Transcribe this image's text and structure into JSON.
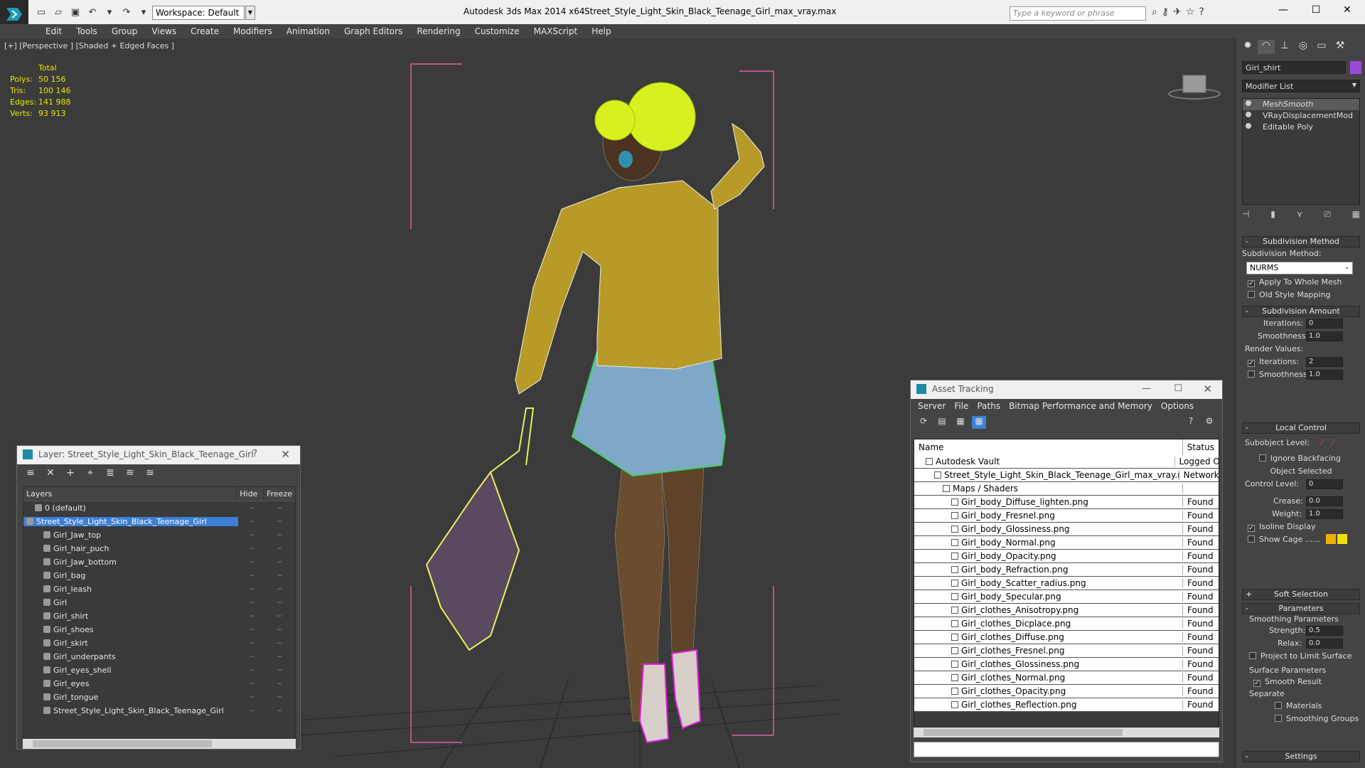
{
  "titlebar": {
    "app_title": "Autodesk 3ds Max  2014 x64",
    "file_title": "Street_Style_Light_Skin_Black_Teenage_Girl_max_vray.max",
    "workspace": "Workspace: Default",
    "search_placeholder": "Type a keyword or phrase"
  },
  "menu": [
    "Edit",
    "Tools",
    "Group",
    "Views",
    "Create",
    "Modifiers",
    "Animation",
    "Graph Editors",
    "Rendering",
    "Customize",
    "MAXScript",
    "Help"
  ],
  "viewport": {
    "label": "[+] [Perspective ] [Shaded + Edged Faces ]",
    "stats": {
      "header": "Total",
      "rows": [
        {
          "k": "Polys:",
          "v": "50 156"
        },
        {
          "k": "Tris:",
          "v": "100 146"
        },
        {
          "k": "Edges:",
          "v": "141 988"
        },
        {
          "k": "Verts:",
          "v": "93 913"
        }
      ]
    }
  },
  "layer_dialog": {
    "title": "Layer: Street_Style_Light_Skin_Black_Teenage_Girl",
    "help": "?",
    "close": "✕",
    "headers": {
      "name": "Layers",
      "hide": "Hide",
      "freeze": "Freeze"
    },
    "rows": [
      {
        "name": "0 (default)",
        "indent": 1
      },
      {
        "name": "Street_Style_Light_Skin_Black_Teenage_Girl",
        "indent": 0,
        "selected": true
      },
      {
        "name": "Girl_Jaw_top",
        "indent": 2
      },
      {
        "name": "Girl_hair_puch",
        "indent": 2
      },
      {
        "name": "Girl_Jaw_bottom",
        "indent": 2
      },
      {
        "name": "Girl_bag",
        "indent": 2
      },
      {
        "name": "Girl_leash",
        "indent": 2
      },
      {
        "name": "Girl",
        "indent": 2
      },
      {
        "name": "Girl_shirt",
        "indent": 2
      },
      {
        "name": "Girl_shoes",
        "indent": 2
      },
      {
        "name": "Girl_skirt",
        "indent": 2
      },
      {
        "name": "Girl_underpants",
        "indent": 2
      },
      {
        "name": "Girl_eyes_shell",
        "indent": 2
      },
      {
        "name": "Girl_eyes",
        "indent": 2
      },
      {
        "name": "Girl_tongue",
        "indent": 2
      },
      {
        "name": "Street_Style_Light_Skin_Black_Teenage_Girl",
        "indent": 2
      }
    ]
  },
  "asset_dialog": {
    "title": "Asset Tracking",
    "menu": [
      "Server",
      "File",
      "Paths",
      "Bitmap Performance and Memory",
      "Options"
    ],
    "headers": {
      "name": "Name",
      "status": "Status"
    },
    "rows": [
      {
        "name": "Autodesk Vault",
        "status": "Logged O",
        "indent": 1
      },
      {
        "name": "Street_Style_Light_Skin_Black_Teenage_Girl_max_vray.max",
        "status": "Network",
        "indent": 2
      },
      {
        "name": "Maps / Shaders",
        "status": "",
        "indent": 3
      },
      {
        "name": "Girl_body_Diffuse_lighten.png",
        "status": "Found",
        "indent": 4
      },
      {
        "name": "Girl_body_Fresnel.png",
        "status": "Found",
        "indent": 4
      },
      {
        "name": "Girl_body_Glossiness.png",
        "status": "Found",
        "indent": 4
      },
      {
        "name": "Girl_body_Normal.png",
        "status": "Found",
        "indent": 4
      },
      {
        "name": "Girl_body_Opacity.png",
        "status": "Found",
        "indent": 4
      },
      {
        "name": "Girl_body_Refraction.png",
        "status": "Found",
        "indent": 4
      },
      {
        "name": "Girl_body_Scatter_radius.png",
        "status": "Found",
        "indent": 4
      },
      {
        "name": "Girl_body_Specular.png",
        "status": "Found",
        "indent": 4
      },
      {
        "name": "Girl_clothes_Anisotropy.png",
        "status": "Found",
        "indent": 4
      },
      {
        "name": "Girl_clothes_Dicplace.png",
        "status": "Found",
        "indent": 4
      },
      {
        "name": "Girl_clothes_Diffuse.png",
        "status": "Found",
        "indent": 4
      },
      {
        "name": "Girl_clothes_Fresnel.png",
        "status": "Found",
        "indent": 4
      },
      {
        "name": "Girl_clothes_Glossiness.png",
        "status": "Found",
        "indent": 4
      },
      {
        "name": "Girl_clothes_Normal.png",
        "status": "Found",
        "indent": 4
      },
      {
        "name": "Girl_clothes_Opacity.png",
        "status": "Found",
        "indent": 4
      },
      {
        "name": "Girl_clothes_Reflection.png",
        "status": "Found",
        "indent": 4
      }
    ]
  },
  "command_panel": {
    "object_name": "Girl_shirt",
    "object_color": "#9a4ad8",
    "modifier_list": "Modifier List",
    "stack": [
      {
        "name": "MeshSmooth",
        "active": true
      },
      {
        "name": "VRayDisplacementMod",
        "active": false
      },
      {
        "name": "Editable Poly",
        "active": false
      }
    ],
    "subdivision_method": {
      "title": "Subdivision Method",
      "label": "Subdivision Method:",
      "value": "NURMS",
      "apply_whole": "Apply To Whole Mesh",
      "old_style": "Old Style Mapping"
    },
    "subdivision_amount": {
      "title": "Subdivision Amount",
      "iterations_label": "Iterations:",
      "iterations": "0",
      "smoothness_label": "Smoothness:",
      "smoothness": "1.0",
      "render_values": "Render Values:",
      "r_iterations_label": "Iterations:",
      "r_iterations": "2",
      "r_smoothness_label": "Smoothness:",
      "r_smoothness": "1.0"
    },
    "local_control": {
      "title": "Local Control",
      "subobject": "Subobject Level:",
      "ignore_backfacing": "Ignore Backfacing",
      "object_selected": "Object Selected",
      "control_level_label": "Control Level:",
      "control_level": "0",
      "crease_label": "Crease:",
      "crease": "0.0",
      "weight_label": "Weight:",
      "weight": "1.0",
      "isoline": "Isoline Display",
      "show_cage": "Show Cage ......",
      "cage_color1": "#f0b000",
      "cage_color2": "#f0e000"
    },
    "soft_selection": "Soft Selection",
    "parameters": {
      "title": "Parameters",
      "smoothing_params": "Smoothing Parameters",
      "strength_label": "Strength:",
      "strength": "0.5",
      "relax_label": "Relax:",
      "relax": "0.0",
      "project": "Project to Limit Surface",
      "surface_params": "Surface Parameters",
      "smooth_result": "Smooth Result",
      "separate": "Separate",
      "materials": "Materials",
      "smoothing_groups": "Smoothing Groups"
    },
    "settings": "Settings"
  }
}
